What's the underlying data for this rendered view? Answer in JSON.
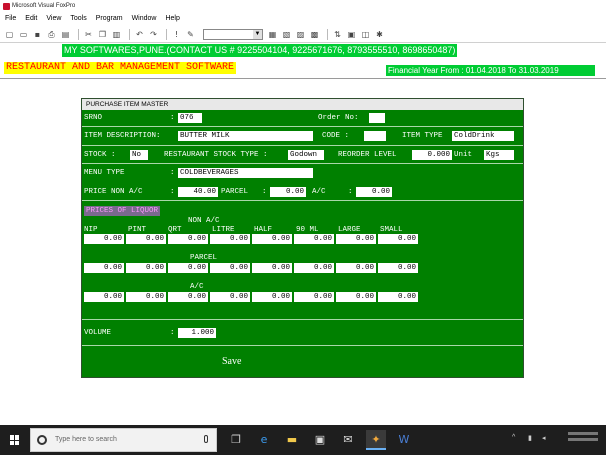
{
  "window": {
    "title": "Microsoft Visual FoxPro"
  },
  "menu": [
    "File",
    "Edit",
    "View",
    "Tools",
    "Program",
    "Window",
    "Help"
  ],
  "toolbar": {
    "icons": [
      "new-file-icon",
      "open-folder-icon",
      "save-icon",
      "print-icon",
      "print-preview-icon",
      "cut-icon",
      "copy-icon",
      "paste-icon",
      "undo-icon",
      "redo-icon",
      "run-icon",
      "modify-icon",
      "form-icon",
      "report-icon",
      "data-icon",
      "command-icon",
      "database-icon",
      "tools-icon",
      "wizard-icon"
    ]
  },
  "banner": {
    "contact": "MY SOFTWARES,PUNE.(CONTACT US # 9225504104, 9225671676, 8793555510, 8698650487)",
    "company": "RESTAURANT AND BAR MANAGEMENT SOFTWARE",
    "financial_year": "Financial Year From : 01.04.2018 To 31.03.2019"
  },
  "form": {
    "title": "PURCHASE ITEM MASTER",
    "srno_label": "SRNO",
    "srno_value": "076",
    "order_no_label": "Order No:",
    "order_no_value": "",
    "item_desc_label": "ITEM DESCRIPTION:",
    "item_desc_value": "BUTTER MILK",
    "code_label": "CODE :",
    "code_value": "",
    "item_type_label": "ITEM TYPE",
    "item_type_value": "ColdDrink",
    "stock_label": "STOCK :",
    "stock_value": "No",
    "rest_stock_type_label": "RESTAURANT STOCK TYPE :",
    "rest_stock_type_value": "Godown",
    "reorder_label": "REORDER LEVEL",
    "reorder_value": "0.000",
    "unit_label": "Unit",
    "unit_value": "Kgs",
    "menu_type_label": "MENU TYPE",
    "menu_type_value": "COLDBEVERAGES",
    "price_label": "PRICE NON A/C",
    "price_value": "40.00",
    "parcel_label": "PARCEL",
    "parcel_value": "0.00",
    "ac_label": "A/C",
    "ac_value": "0.00",
    "liquor_header": "PRICES OF LIQUOR",
    "non_ac_label": "NON A/C",
    "parcel_section_label": "PARCEL",
    "ac_section_label": "A/C",
    "columns": [
      "NIP",
      "PINT",
      "QRT",
      "LITRE",
      "HALF",
      "90 ML",
      "LARGE",
      "SMALL"
    ],
    "rows": {
      "non_ac": [
        "0.00",
        "0.00",
        "0.00",
        "0.00",
        "0.00",
        "0.00",
        "0.00",
        "0.00"
      ],
      "parcel": [
        "0.00",
        "0.00",
        "0.00",
        "0.00",
        "0.00",
        "0.00",
        "0.00",
        "0.00"
      ],
      "ac": [
        "0.00",
        "0.00",
        "0.00",
        "0.00",
        "0.00",
        "0.00",
        "0.00",
        "0.00"
      ]
    },
    "volume_label": "VOLUME",
    "volume_value": "1.000",
    "save_label": "Save"
  },
  "taskbar": {
    "search_placeholder": "Type here to search",
    "apps": [
      "task-view-icon",
      "edge-icon",
      "file-explorer-icon",
      "store-icon",
      "mail-icon",
      "foxpro-icon",
      "word-icon"
    ]
  },
  "colors": {
    "form_bg": "#008000",
    "banner_green": "#00cc33",
    "title_red": "#ff0000",
    "title_yellow": "#ffff00"
  }
}
